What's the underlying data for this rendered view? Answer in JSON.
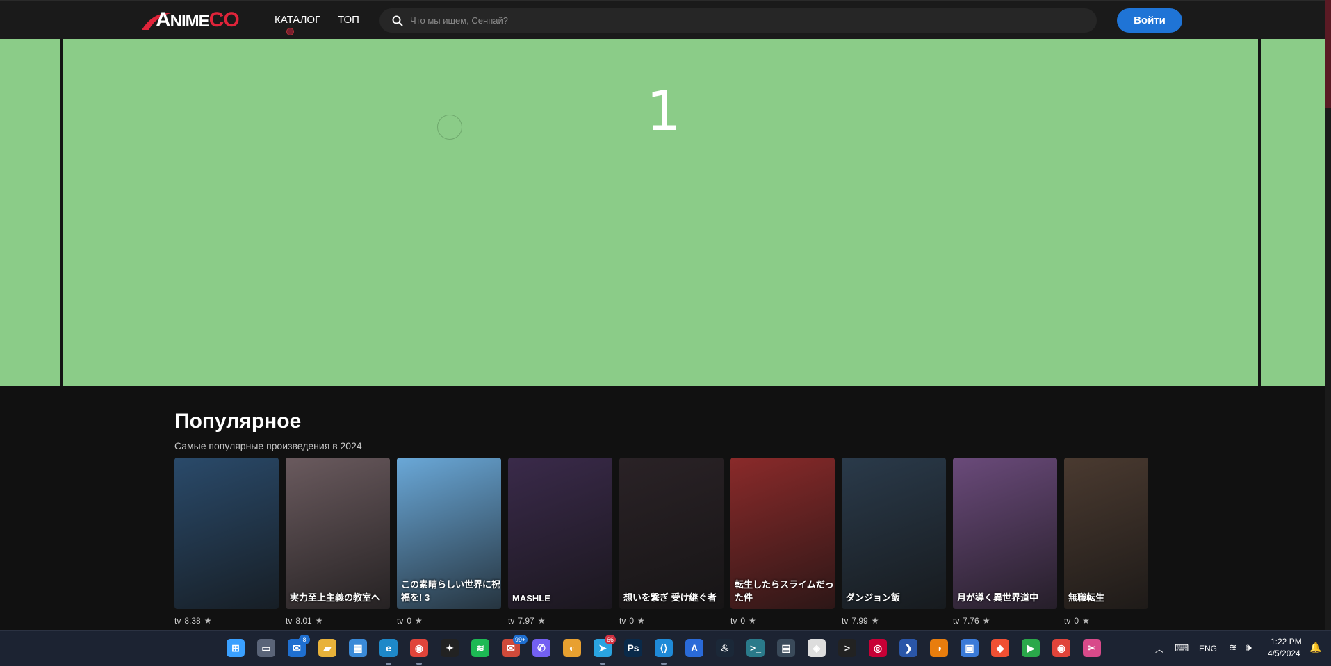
{
  "header": {
    "logo_first": "A",
    "logo_mid": "NIME",
    "logo_co": "CO",
    "nav": [
      {
        "label": "КАТАЛОГ"
      },
      {
        "label": "ТОП"
      }
    ],
    "search_placeholder": "Что мы ищем, Сенпай?",
    "login_label": "Войти",
    "accent_color": "#e0243a",
    "login_color": "#1f74d6"
  },
  "hero": {
    "slide_number": "1",
    "background_color": "#8bcc88"
  },
  "popular": {
    "title": "Популярное",
    "subtitle": "Самые популярные произведения в 2024",
    "items": [
      {
        "type": "tv",
        "rating": "8.38",
        "poster_color": "#2a4a6a",
        "poster_text": ""
      },
      {
        "type": "tv",
        "rating": "8.01",
        "poster_color": "#6a5a5e",
        "poster_text": "実力至上主義の教室へ"
      },
      {
        "type": "tv",
        "rating": "0",
        "poster_color": "#6aa8d8",
        "poster_text": "この素晴らしい世界に祝福を! 3"
      },
      {
        "type": "tv",
        "rating": "7.97",
        "poster_color": "#3a2a4a",
        "poster_text": "MASHLE"
      },
      {
        "type": "tv",
        "rating": "0",
        "poster_color": "#2a2226",
        "poster_text": "想いを繋ぎ 受け継ぐ者"
      },
      {
        "type": "tv",
        "rating": "0",
        "poster_color": "#8a2a2a",
        "poster_text": "転生したらスライムだった件"
      },
      {
        "type": "tv",
        "rating": "7.99",
        "poster_color": "#2a3a4a",
        "poster_text": "ダンジョン飯"
      },
      {
        "type": "tv",
        "rating": "7.76",
        "poster_color": "#6a4a7a",
        "poster_text": "月が導く異世界道中"
      },
      {
        "type": "tv",
        "rating": "0",
        "poster_color": "#4a3a30",
        "poster_text": "無職転生"
      }
    ]
  },
  "taskbar": {
    "badges": {
      "outlook": "8",
      "mail": "99+",
      "telegram": "66"
    },
    "language": "ENG",
    "time": "1:22 PM",
    "date": "4/5/2024",
    "icons": [
      {
        "name": "windows-start-icon",
        "color": "#3aa0ff",
        "glyph": "⊞"
      },
      {
        "name": "task-view-icon",
        "color": "#5a6478",
        "glyph": "▭"
      },
      {
        "name": "outlook-icon",
        "color": "#1f6fd0",
        "glyph": "✉"
      },
      {
        "name": "file-explorer-icon",
        "color": "#e8b23a",
        "glyph": "▰"
      },
      {
        "name": "ms-store-icon",
        "color": "#3a8ad8",
        "glyph": "▦"
      },
      {
        "name": "edge-icon",
        "color": "#1e88c8",
        "glyph": "e"
      },
      {
        "name": "chrome-icon",
        "color": "#e0443a",
        "glyph": "◉"
      },
      {
        "name": "figma-icon",
        "color": "#222",
        "glyph": "✦"
      },
      {
        "name": "spotify-icon",
        "color": "#1db954",
        "glyph": "≋"
      },
      {
        "name": "mail-icon",
        "color": "#d04a3a",
        "glyph": "✉"
      },
      {
        "name": "viber-icon",
        "color": "#7360f2",
        "glyph": "✆"
      },
      {
        "name": "rainbow-app-icon",
        "color": "#e8a030",
        "glyph": "◐"
      },
      {
        "name": "telegram-icon",
        "color": "#2aa3e0",
        "glyph": "➤"
      },
      {
        "name": "photoshop-icon",
        "color": "#0a2a4a",
        "glyph": "Ps"
      },
      {
        "name": "vscode-icon",
        "color": "#1f8ad8",
        "glyph": "⟨⟩"
      },
      {
        "name": "xcode-app-icon",
        "color": "#2a6ad8",
        "glyph": "A"
      },
      {
        "name": "steam-icon",
        "color": "#1b2838",
        "glyph": "♨"
      },
      {
        "name": "terminal-app-icon",
        "color": "#2a7a8a",
        "glyph": ">_"
      },
      {
        "name": "calculator-icon",
        "color": "#3a4a5a",
        "glyph": "▤"
      },
      {
        "name": "unity-icon",
        "color": "#ddd",
        "glyph": "◈"
      },
      {
        "name": "cmd-icon",
        "color": "#222",
        "glyph": ">"
      },
      {
        "name": "debian-icon",
        "color": "#c80036",
        "glyph": "◎"
      },
      {
        "name": "powershell-icon",
        "color": "#2a56a8",
        "glyph": "❯"
      },
      {
        "name": "blender-icon",
        "color": "#e87d0d",
        "glyph": "◑"
      },
      {
        "name": "remote-desktop-icon",
        "color": "#3a7ad8",
        "glyph": "▣"
      },
      {
        "name": "git-icon",
        "color": "#f05033",
        "glyph": "◆"
      },
      {
        "name": "media-player-icon",
        "color": "#2aa84a",
        "glyph": "▶"
      },
      {
        "name": "chrome-alt-icon",
        "color": "#e0443a",
        "glyph": "◉"
      },
      {
        "name": "snipping-tool-icon",
        "color": "#d84a8a",
        "glyph": "✂"
      }
    ]
  }
}
